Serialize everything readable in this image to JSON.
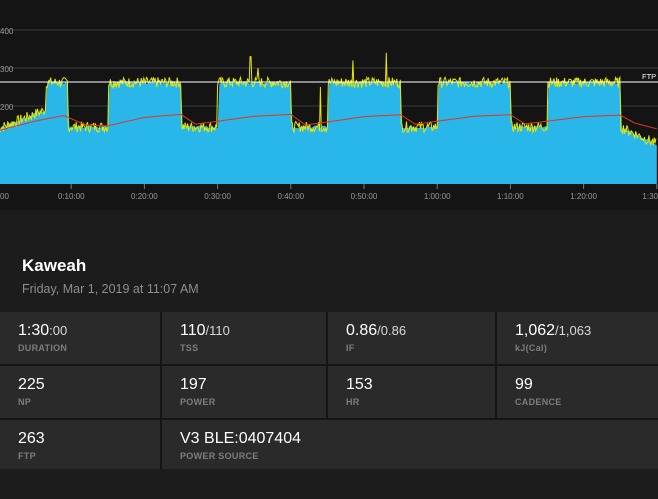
{
  "chart": {
    "y_ticks": [
      "400",
      "300",
      "200"
    ],
    "x_ticks": [
      "00",
      "0:10:00",
      "0:20:00",
      "0:30:00",
      "0:40:00",
      "0:50:00",
      "1:00:00",
      "1:10:00",
      "1:20:00",
      "1:30"
    ],
    "ftp_label": "FTP",
    "colors": {
      "power_fill": "#29b6e8",
      "power_line": "#e6e600",
      "hr_line": "#e5331e",
      "ftp_line": "#ffffff",
      "grid": "#3a3a3a"
    }
  },
  "chart_data": {
    "type": "area",
    "y_tick_values": [
      400,
      300,
      200
    ],
    "x_tick_minutes": [
      0,
      10,
      20,
      30,
      40,
      50,
      60,
      70,
      80,
      90
    ],
    "ftp": 263,
    "target_intervals": [
      {
        "start_min": 0,
        "end_min": 6.5,
        "target_w": 140,
        "ramp_to_w": 190
      },
      {
        "start_min": 6.5,
        "end_min": 9.5,
        "target_w": 262
      },
      {
        "start_min": 9.5,
        "end_min": 15,
        "target_w": 145
      },
      {
        "start_min": 15,
        "end_min": 25,
        "target_w": 262
      },
      {
        "start_min": 25,
        "end_min": 30,
        "target_w": 145
      },
      {
        "start_min": 30,
        "end_min": 40,
        "target_w": 262
      },
      {
        "start_min": 40,
        "end_min": 45,
        "target_w": 145
      },
      {
        "start_min": 45,
        "end_min": 55,
        "target_w": 262
      },
      {
        "start_min": 55,
        "end_min": 60,
        "target_w": 145
      },
      {
        "start_min": 60,
        "end_min": 70,
        "target_w": 262
      },
      {
        "start_min": 70,
        "end_min": 75,
        "target_w": 145
      },
      {
        "start_min": 75,
        "end_min": 85,
        "target_w": 262
      },
      {
        "start_min": 85,
        "end_min": 90,
        "target_w": 145,
        "ramp_to_w": 100
      }
    ],
    "heart_rate_trend": [
      {
        "minute": 0,
        "value": 135
      },
      {
        "minute": 5,
        "value": 160
      },
      {
        "minute": 9,
        "value": 175
      },
      {
        "minute": 12,
        "value": 150
      },
      {
        "minute": 15,
        "value": 148
      },
      {
        "minute": 20,
        "value": 170
      },
      {
        "minute": 25,
        "value": 178
      },
      {
        "minute": 27,
        "value": 152
      },
      {
        "minute": 30,
        "value": 160
      },
      {
        "minute": 35,
        "value": 173
      },
      {
        "minute": 40,
        "value": 178
      },
      {
        "minute": 42,
        "value": 150
      },
      {
        "minute": 45,
        "value": 158
      },
      {
        "minute": 50,
        "value": 172
      },
      {
        "minute": 55,
        "value": 177
      },
      {
        "minute": 57,
        "value": 152
      },
      {
        "minute": 60,
        "value": 160
      },
      {
        "minute": 65,
        "value": 173
      },
      {
        "minute": 70,
        "value": 177
      },
      {
        "minute": 72,
        "value": 153
      },
      {
        "minute": 75,
        "value": 160
      },
      {
        "minute": 80,
        "value": 172
      },
      {
        "minute": 85,
        "value": 176
      },
      {
        "minute": 87,
        "value": 155
      },
      {
        "minute": 90,
        "value": 140
      }
    ],
    "power_spikes": [
      {
        "minute": 34.5,
        "value": 330
      },
      {
        "minute": 35.5,
        "value": 300
      },
      {
        "minute": 48.5,
        "value": 320
      },
      {
        "minute": 53,
        "value": 340
      },
      {
        "minute": 44,
        "value": 250
      }
    ],
    "ylim": [
      100,
      430
    ],
    "xlim": [
      0,
      90
    ]
  },
  "workout": {
    "title": "Kaweah",
    "date": "Friday, Mar 1, 2019 at 11:07 AM"
  },
  "stats": [
    {
      "value": "1:30",
      "sub": ":00",
      "label": "DURATION"
    },
    {
      "value": "110",
      "sub": "/110",
      "label": "TSS"
    },
    {
      "value": "0.86",
      "sub": "/0.86",
      "label": "IF"
    },
    {
      "value": "1,062",
      "sub": "/1,063",
      "label": "kJ(Cal)"
    },
    {
      "value": "225",
      "sub": "",
      "label": "NP"
    },
    {
      "value": "197",
      "sub": "",
      "label": "POWER"
    },
    {
      "value": "153",
      "sub": "",
      "label": "HR"
    },
    {
      "value": "99",
      "sub": "",
      "label": "CADENCE"
    },
    {
      "value": "263",
      "sub": "",
      "label": "FTP"
    },
    {
      "value": "V3 BLE:0407404",
      "sub": "",
      "label": "POWER SOURCE"
    }
  ]
}
